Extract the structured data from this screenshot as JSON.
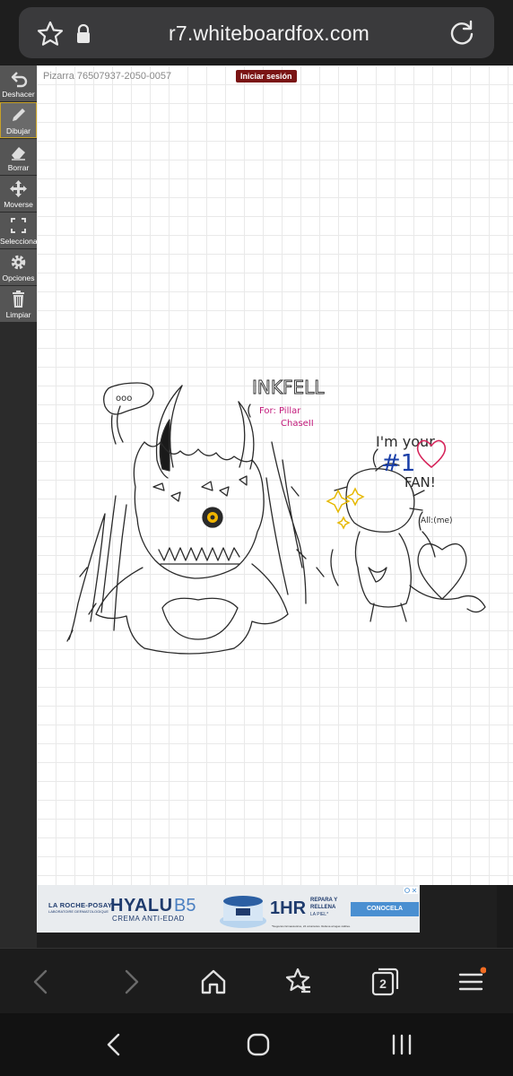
{
  "browser": {
    "url": "r7.whiteboardfox.com",
    "tab_count": "2",
    "icons": [
      "star-icon",
      "lock-icon",
      "reload-icon",
      "back-icon",
      "forward-icon",
      "home-icon",
      "bookmarks-icon",
      "tabs-icon",
      "menu-icon"
    ],
    "menu_notification_color": "#f26c22"
  },
  "toolbar": {
    "tools": [
      {
        "label": "Deshacer",
        "icon": "undo-icon"
      },
      {
        "label": "Dibujar",
        "icon": "pencil-icon",
        "active": true
      },
      {
        "label": "Borrar",
        "icon": "eraser-icon"
      },
      {
        "label": "Moverse",
        "icon": "move-icon"
      },
      {
        "label": "Seleccionar",
        "icon": "select-icon"
      },
      {
        "label": "Opciones",
        "icon": "gear-icon"
      },
      {
        "label": "Limpiar",
        "icon": "trash-icon"
      }
    ]
  },
  "board": {
    "id_label": "Pizarra 76507937-2050-0057",
    "login_label": "Iniciar sesión",
    "drawing_texts": {
      "title": "INKFELL",
      "dedication_1": "For: Pillar",
      "dedication_2": "ChaseII",
      "ellipsis": "ooo",
      "fan_line1": "I'm your",
      "fan_number": "#1",
      "fan_line2": "FAN!",
      "signature": "All:(me)"
    },
    "colors": {
      "line": "#2a2a2a",
      "dedication": "#c2187a",
      "number": "#1a3fa8",
      "heart": "#d6245a",
      "sparkle": "#e6b800",
      "eye": "#f0b400"
    }
  },
  "ad": {
    "brand": "LA ROCHE-POSAY",
    "brand_sub": "LABORATOIRE DERMATOLOGIQUE",
    "title_a": "HYALU",
    "title_b": "B5",
    "subtitle": "CREMA ANTI-EDAD",
    "hr": "1HR",
    "fill_1": "REPARA Y",
    "fill_2": "RELLENA",
    "fill_3": "LA PIEL*",
    "cta": "CONOCELA",
    "disclaimer": "*Negocios farmacéuticos, 24 voluntarios. Rellena arrugas visibles.",
    "info_icon": "ad-choices-icon"
  }
}
